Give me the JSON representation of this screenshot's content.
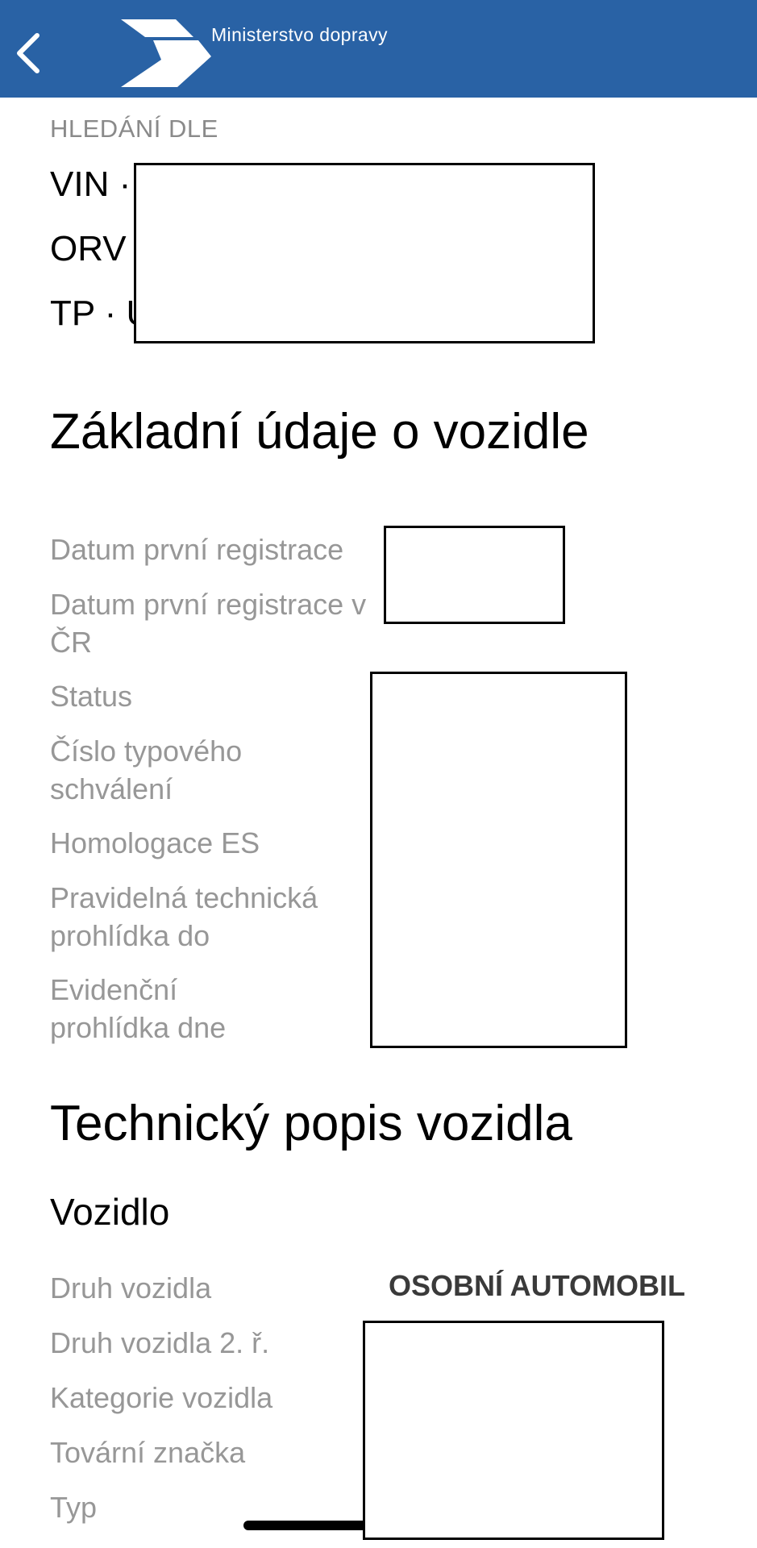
{
  "header": {
    "org_name": "Ministerstvo dopravy",
    "back_icon": "chevron-left-icon",
    "logo_icon": "ministry-arrow-logo",
    "background_color": "#2962a5"
  },
  "search": {
    "section_label": "HLEDÁNÍ DLE",
    "rows": [
      {
        "prefix": "VIN ·"
      },
      {
        "prefix": "ORV"
      },
      {
        "prefix": "TP · U"
      }
    ]
  },
  "basic_info": {
    "title": "Základní údaje o vozidle",
    "fields": [
      {
        "label": "Datum první registrace"
      },
      {
        "label": "Datum první registrace v ČR"
      },
      {
        "label": "Status"
      },
      {
        "label": "Číslo typového schválení"
      },
      {
        "label": "Homologace ES"
      },
      {
        "label": "Pravidelná technická prohlídka do"
      },
      {
        "label": "Evidenční prohlídka dne"
      }
    ]
  },
  "technical": {
    "title": "Technický popis vozidla",
    "subtitle": "Vozidlo",
    "fields": [
      {
        "label": "Druh vozidla",
        "value": "OSOBNÍ AUTOMOBIL"
      },
      {
        "label": "Druh vozidla 2. ř."
      },
      {
        "label": "Kategorie vozidla"
      },
      {
        "label": "Tovární značka"
      },
      {
        "label": "Typ"
      }
    ]
  }
}
